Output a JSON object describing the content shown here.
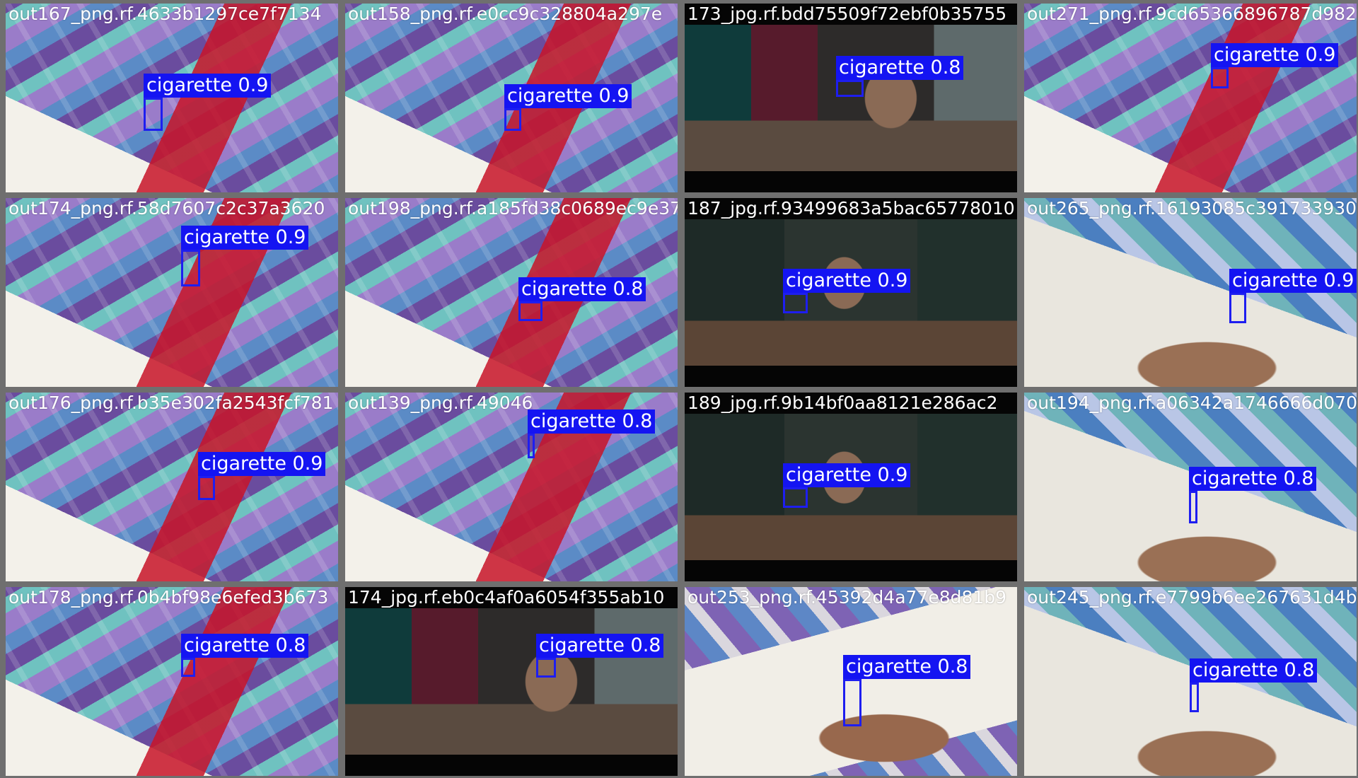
{
  "mosaic": {
    "background_color": "#6f6f6f",
    "box_color": "#1e1ef0",
    "tiles": [
      {
        "filename": "out167_png.rf.4633b1297ce7f7134",
        "scene": "bed",
        "detections": [
          {
            "label": "cigarette 0.9"
          }
        ]
      },
      {
        "filename": "out158_png.rf.e0cc9c328804a297e",
        "scene": "bed",
        "detections": [
          {
            "label": "cigarette 0.9"
          }
        ]
      },
      {
        "filename": "173_jpg.rf.bdd75509f72ebf0b35755",
        "scene": "man",
        "detections": [
          {
            "label": "cigarette 0.8"
          }
        ]
      },
      {
        "filename": "out271_png.rf.9cd65366896787d982",
        "scene": "bed",
        "detections": [
          {
            "label": "cigarette 0.9"
          }
        ]
      },
      {
        "filename": "out174_png.rf.58d7607c2c37a3620",
        "scene": "bed",
        "detections": [
          {
            "label": "cigarette 0.9"
          }
        ]
      },
      {
        "filename": "out198_png.rf.a185fd38c0689ec9e37",
        "scene": "bed",
        "detections": [
          {
            "label": "cigarette 0.8"
          }
        ]
      },
      {
        "filename": "187_jpg.rf.93499683a5bac65778010",
        "scene": "man2",
        "detections": [
          {
            "label": "cigarette 0.9"
          }
        ]
      },
      {
        "filename": "out265_png.rf.16193085c391733930",
        "scene": "paper",
        "detections": [
          {
            "label": "cigarette 0.9"
          }
        ]
      },
      {
        "filename": "out176_png.rf.b35e302fa2543fcf781",
        "scene": "bed",
        "detections": [
          {
            "label": "cigarette 0.9"
          }
        ]
      },
      {
        "filename": "out139_png.rf.49046",
        "scene": "bed",
        "detections": [
          {
            "label": "cigarette 0.8"
          }
        ]
      },
      {
        "filename": "189_jpg.rf.9b14bf0aa8121e286ac2",
        "scene": "man2",
        "detections": [
          {
            "label": "cigarette 0.9"
          }
        ]
      },
      {
        "filename": "out194_png.rf.a06342a1746666d070",
        "scene": "paper",
        "detections": [
          {
            "label": "cigarette 0.8"
          }
        ]
      },
      {
        "filename": "out178_png.rf.0b4bf98e6efed3b673",
        "scene": "bed",
        "detections": [
          {
            "label": "cigarette 0.8"
          }
        ]
      },
      {
        "filename": "174_jpg.rf.eb0c4af0a6054f355ab10",
        "scene": "man",
        "detections": [
          {
            "label": "cigarette 0.8"
          }
        ]
      },
      {
        "filename": "out253_png.rf.45392d4a77e8d81b9",
        "scene": "paper2",
        "detections": [
          {
            "label": "cigarette 0.8"
          }
        ]
      },
      {
        "filename": "out245_png.rf.e7799b6ee267631d4b",
        "scene": "paper",
        "detections": [
          {
            "label": "cigarette 0.8"
          }
        ]
      }
    ]
  }
}
